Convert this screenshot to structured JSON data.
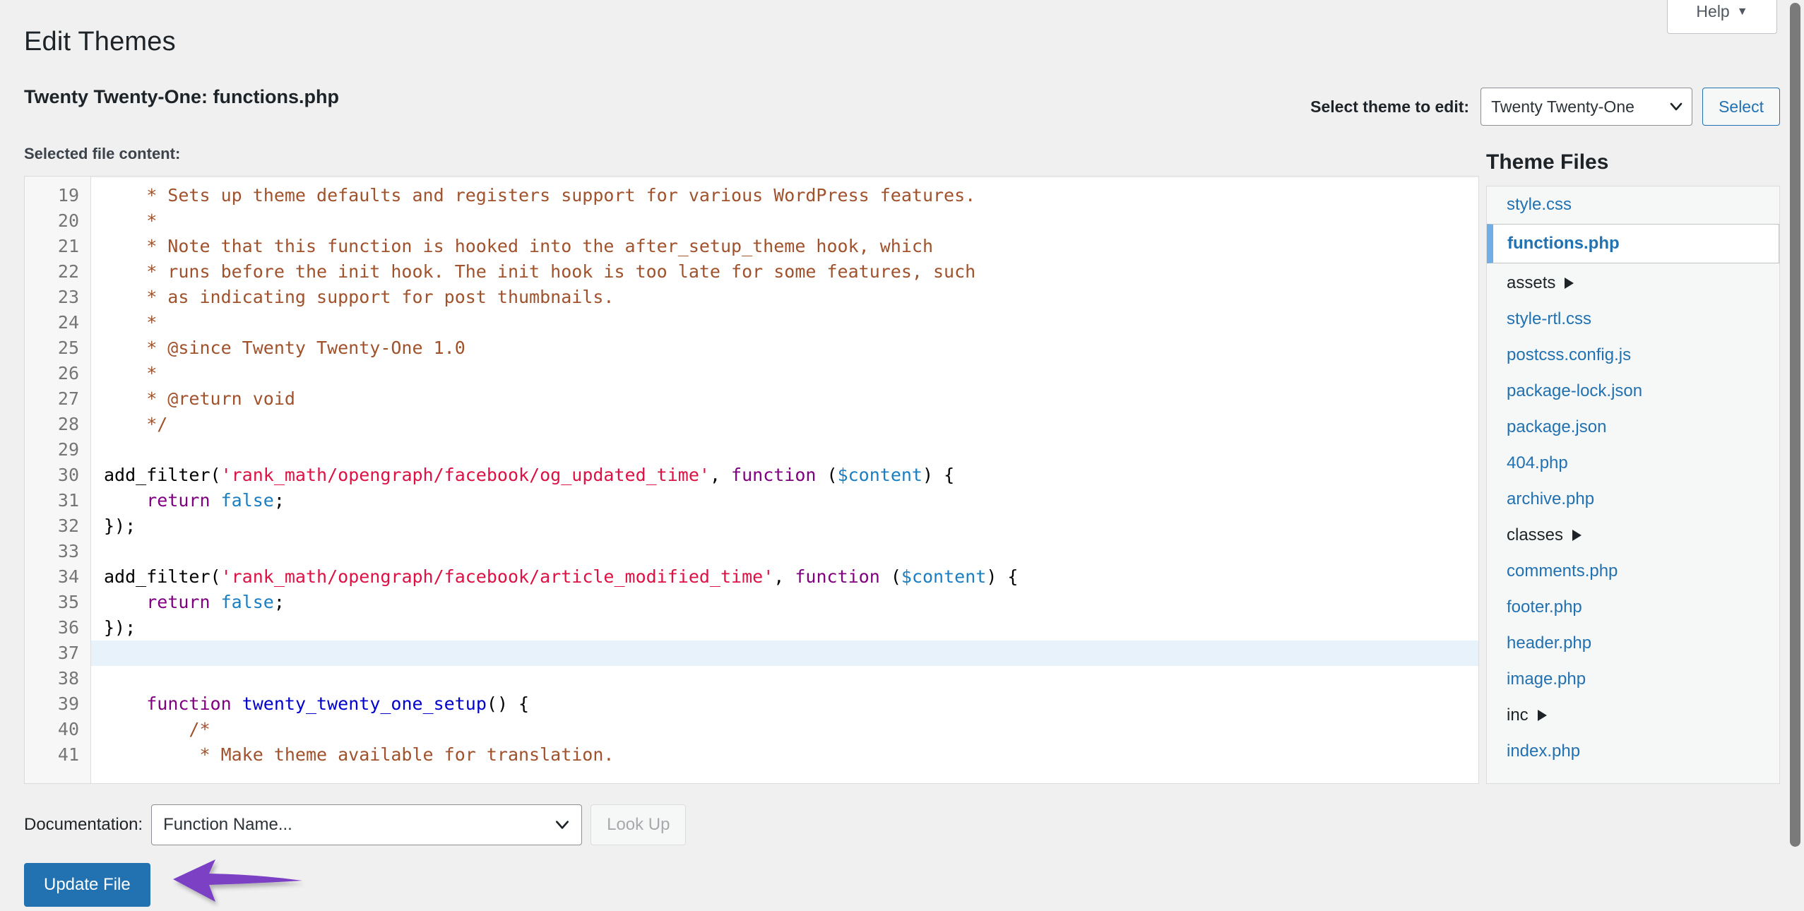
{
  "header": {
    "help_label": "Help",
    "help_caret": "▼",
    "page_title": "Edit Themes"
  },
  "theme_bar": {
    "heading": "Twenty Twenty-One: functions.php",
    "select_theme_label": "Select theme to edit:",
    "selected_theme": "Twenty Twenty-One",
    "select_button": "Select"
  },
  "editor": {
    "file_content_label": "Selected file content:",
    "active_line": 37,
    "lines": [
      {
        "n": 19,
        "tokens": [
          {
            "t": "    * Sets up theme defaults and registers support for various WordPress features.",
            "c": "t-com"
          }
        ]
      },
      {
        "n": 20,
        "tokens": [
          {
            "t": "    *",
            "c": "t-com"
          }
        ]
      },
      {
        "n": 21,
        "tokens": [
          {
            "t": "    * Note that this function is hooked into the after_setup_theme hook, which",
            "c": "t-com"
          }
        ]
      },
      {
        "n": 22,
        "tokens": [
          {
            "t": "    * runs before the init hook. The init hook is too late for some features, such",
            "c": "t-com"
          }
        ]
      },
      {
        "n": 23,
        "tokens": [
          {
            "t": "    * as indicating support for post thumbnails.",
            "c": "t-com"
          }
        ]
      },
      {
        "n": 24,
        "tokens": [
          {
            "t": "    *",
            "c": "t-com"
          }
        ]
      },
      {
        "n": 25,
        "tokens": [
          {
            "t": "    * @since Twenty Twenty-One 1.0",
            "c": "t-com"
          }
        ]
      },
      {
        "n": 26,
        "tokens": [
          {
            "t": "    *",
            "c": "t-com"
          }
        ]
      },
      {
        "n": 27,
        "tokens": [
          {
            "t": "    * @return void",
            "c": "t-com"
          }
        ]
      },
      {
        "n": 28,
        "tokens": [
          {
            "t": "    */",
            "c": "t-com"
          }
        ]
      },
      {
        "n": 29,
        "tokens": [
          {
            "t": "",
            "c": "t-def"
          }
        ]
      },
      {
        "n": 30,
        "tokens": [
          {
            "t": "add_filter",
            "c": "t-def"
          },
          {
            "t": "(",
            "c": "t-pun"
          },
          {
            "t": "'rank_math/opengraph/facebook/og_updated_time'",
            "c": "t-str"
          },
          {
            "t": ", ",
            "c": "t-pun"
          },
          {
            "t": "function",
            "c": "t-kw"
          },
          {
            "t": " (",
            "c": "t-pun"
          },
          {
            "t": "$content",
            "c": "t-var"
          },
          {
            "t": ") {",
            "c": "t-pun"
          }
        ]
      },
      {
        "n": 31,
        "tokens": [
          {
            "t": "    ",
            "c": "t-def"
          },
          {
            "t": "return",
            "c": "t-kw"
          },
          {
            "t": " ",
            "c": "t-def"
          },
          {
            "t": "false",
            "c": "t-var"
          },
          {
            "t": ";",
            "c": "t-pun"
          }
        ]
      },
      {
        "n": 32,
        "tokens": [
          {
            "t": "});",
            "c": "t-pun"
          }
        ]
      },
      {
        "n": 33,
        "tokens": [
          {
            "t": "",
            "c": "t-def"
          }
        ]
      },
      {
        "n": 34,
        "tokens": [
          {
            "t": "add_filter",
            "c": "t-def"
          },
          {
            "t": "(",
            "c": "t-pun"
          },
          {
            "t": "'rank_math/opengraph/facebook/article_modified_time'",
            "c": "t-str"
          },
          {
            "t": ", ",
            "c": "t-pun"
          },
          {
            "t": "function",
            "c": "t-kw"
          },
          {
            "t": " (",
            "c": "t-pun"
          },
          {
            "t": "$content",
            "c": "t-var"
          },
          {
            "t": ") {",
            "c": "t-pun"
          }
        ]
      },
      {
        "n": 35,
        "tokens": [
          {
            "t": "    ",
            "c": "t-def"
          },
          {
            "t": "return",
            "c": "t-kw"
          },
          {
            "t": " ",
            "c": "t-def"
          },
          {
            "t": "false",
            "c": "t-var"
          },
          {
            "t": ";",
            "c": "t-pun"
          }
        ]
      },
      {
        "n": 36,
        "tokens": [
          {
            "t": "});",
            "c": "t-pun"
          }
        ]
      },
      {
        "n": 37,
        "tokens": [
          {
            "t": "",
            "c": "t-def"
          }
        ]
      },
      {
        "n": 38,
        "tokens": [
          {
            "t": "",
            "c": "t-def"
          }
        ]
      },
      {
        "n": 39,
        "tokens": [
          {
            "t": "    ",
            "c": "t-def"
          },
          {
            "t": "function",
            "c": "t-kw"
          },
          {
            "t": " ",
            "c": "t-def"
          },
          {
            "t": "twenty_twenty_one_setup",
            "c": "t-fn"
          },
          {
            "t": "() {",
            "c": "t-pun"
          }
        ]
      },
      {
        "n": 40,
        "tokens": [
          {
            "t": "        /*",
            "c": "t-com"
          }
        ]
      },
      {
        "n": 41,
        "tokens": [
          {
            "t": "         * Make theme available for translation.",
            "c": "t-com"
          }
        ]
      }
    ]
  },
  "theme_files": {
    "title": "Theme Files",
    "items": [
      {
        "label": "style.css",
        "type": "file",
        "current": false
      },
      {
        "label": "functions.php",
        "type": "file",
        "current": true
      },
      {
        "label": "assets",
        "type": "folder",
        "current": false
      },
      {
        "label": "style-rtl.css",
        "type": "file",
        "current": false
      },
      {
        "label": "postcss.config.js",
        "type": "file",
        "current": false
      },
      {
        "label": "package-lock.json",
        "type": "file",
        "current": false
      },
      {
        "label": "package.json",
        "type": "file",
        "current": false
      },
      {
        "label": "404.php",
        "type": "file",
        "current": false
      },
      {
        "label": "archive.php",
        "type": "file",
        "current": false
      },
      {
        "label": "classes",
        "type": "folder",
        "current": false
      },
      {
        "label": "comments.php",
        "type": "file",
        "current": false
      },
      {
        "label": "footer.php",
        "type": "file",
        "current": false
      },
      {
        "label": "header.php",
        "type": "file",
        "current": false
      },
      {
        "label": "image.php",
        "type": "file",
        "current": false
      },
      {
        "label": "inc",
        "type": "folder",
        "current": false
      },
      {
        "label": "index.php",
        "type": "file",
        "current": false
      }
    ]
  },
  "footer": {
    "documentation_label": "Documentation:",
    "documentation_value": "Function Name...",
    "lookup_label": "Look Up",
    "update_file_label": "Update File"
  },
  "annotation": {
    "arrow_color": "#7b3fc4",
    "arrow_direction": "left",
    "points_at": "Update File"
  },
  "colors": {
    "accent_blue": "#2271b1",
    "link_blue": "#2271b1",
    "page_bg": "#f0f0f1",
    "comment_brown": "#a0522d",
    "string_red": "#d14",
    "keyword_purple": "#800080",
    "active_line_bg": "#e8f2fb"
  }
}
